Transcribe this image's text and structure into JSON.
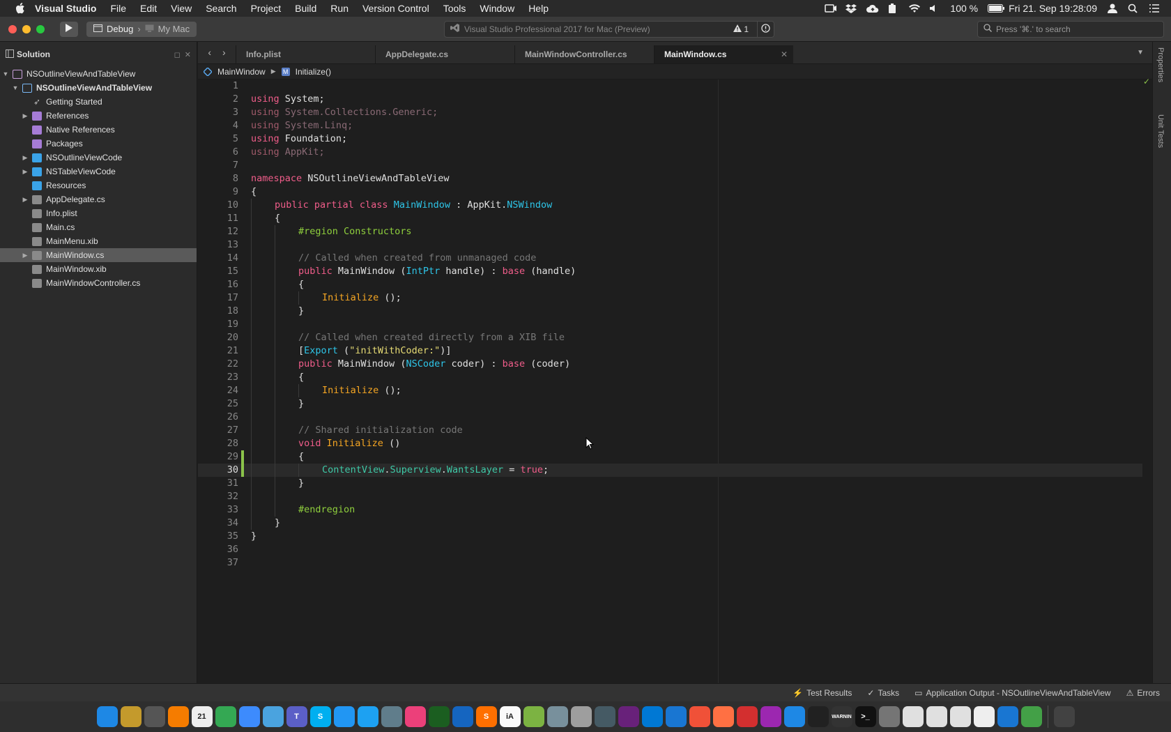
{
  "menubar": {
    "app_name": "Visual Studio",
    "items": [
      "File",
      "Edit",
      "View",
      "Search",
      "Project",
      "Build",
      "Run",
      "Version Control",
      "Tools",
      "Window",
      "Help"
    ],
    "battery": "100 %",
    "clock": "Fri 21. Sep  19:28:09"
  },
  "toolbar": {
    "config": "Debug",
    "target": "My Mac",
    "status_text": "Visual Studio Professional 2017 for Mac (Preview)",
    "warning_count": "1",
    "search_placeholder": "Press '⌘.' to search"
  },
  "solution": {
    "title": "Solution",
    "items": [
      {
        "label": "NSOutlineViewAndTableView",
        "icon": "solution-icon",
        "arrow": "▼",
        "depth": 0,
        "bold": false
      },
      {
        "label": "NSOutlineViewAndTableView",
        "icon": "project-icon",
        "arrow": "▼",
        "depth": 1,
        "bold": true
      },
      {
        "label": "Getting Started",
        "icon": "rocket-icon",
        "arrow": "",
        "depth": 2,
        "bold": false
      },
      {
        "label": "References",
        "icon": "references-icon",
        "arrow": "▶",
        "depth": 2,
        "bold": false
      },
      {
        "label": "Native References",
        "icon": "references-icon",
        "arrow": "",
        "depth": 2,
        "bold": false
      },
      {
        "label": "Packages",
        "icon": "references-icon",
        "arrow": "",
        "depth": 2,
        "bold": false
      },
      {
        "label": "NSOutlineViewCode",
        "icon": "folder-icon",
        "arrow": "▶",
        "depth": 2,
        "bold": false
      },
      {
        "label": "NSTableViewCode",
        "icon": "folder-icon",
        "arrow": "▶",
        "depth": 2,
        "bold": false
      },
      {
        "label": "Resources",
        "icon": "folder-icon",
        "arrow": "",
        "depth": 2,
        "bold": false
      },
      {
        "label": "AppDelegate.cs",
        "icon": "csharp-file-icon",
        "arrow": "▶",
        "depth": 2,
        "bold": false
      },
      {
        "label": "Info.plist",
        "icon": "plist-file-icon",
        "arrow": "",
        "depth": 2,
        "bold": false
      },
      {
        "label": "Main.cs",
        "icon": "csharp-file-icon",
        "arrow": "",
        "depth": 2,
        "bold": false
      },
      {
        "label": "MainMenu.xib",
        "icon": "xib-file-icon",
        "arrow": "",
        "depth": 2,
        "bold": false
      },
      {
        "label": "MainWindow.cs",
        "icon": "csharp-file-icon",
        "arrow": "▶",
        "depth": 2,
        "bold": false,
        "selected": true
      },
      {
        "label": "MainWindow.xib",
        "icon": "xib-file-icon",
        "arrow": "",
        "depth": 2,
        "bold": false
      },
      {
        "label": "MainWindowController.cs",
        "icon": "csharp-file-icon",
        "arrow": "",
        "depth": 2,
        "bold": false
      }
    ]
  },
  "tabs": [
    {
      "label": "Info.plist",
      "active": false
    },
    {
      "label": "AppDelegate.cs",
      "active": false
    },
    {
      "label": "MainWindowController.cs",
      "active": false
    },
    {
      "label": "MainWindow.cs",
      "active": true
    }
  ],
  "pathbar": {
    "class_name": "MainWindow",
    "member": "Initialize()"
  },
  "code": {
    "current_line": 30,
    "changed_lines": [
      29,
      30
    ],
    "lines": [
      {
        "n": 1,
        "indent": 0,
        "tokens": []
      },
      {
        "n": 2,
        "indent": 0,
        "tokens": [
          [
            "k",
            "using"
          ],
          [
            "pl",
            " System;"
          ]
        ]
      },
      {
        "n": 3,
        "indent": 0,
        "tokens": [
          [
            "kd",
            "using"
          ],
          [
            "dim",
            " System.Collections.Generic;"
          ]
        ]
      },
      {
        "n": 4,
        "indent": 0,
        "tokens": [
          [
            "kd",
            "using"
          ],
          [
            "dim",
            " System.Linq;"
          ]
        ]
      },
      {
        "n": 5,
        "indent": 0,
        "tokens": [
          [
            "k",
            "using"
          ],
          [
            "pl",
            " Foundation;"
          ]
        ]
      },
      {
        "n": 6,
        "indent": 0,
        "tokens": [
          [
            "kd",
            "using"
          ],
          [
            "dim",
            " AppKit;"
          ]
        ]
      },
      {
        "n": 7,
        "indent": 0,
        "tokens": []
      },
      {
        "n": 8,
        "indent": 0,
        "tokens": [
          [
            "k",
            "namespace"
          ],
          [
            "pl",
            " NSOutlineViewAndTableView"
          ]
        ]
      },
      {
        "n": 9,
        "indent": 0,
        "tokens": [
          [
            "pl",
            "{"
          ]
        ]
      },
      {
        "n": 10,
        "indent": 1,
        "tokens": [
          [
            "k",
            "public partial class"
          ],
          [
            "pl",
            " "
          ],
          [
            "ty",
            "MainWindow"
          ],
          [
            "pl",
            " : AppKit."
          ],
          [
            "ty",
            "NSWindow"
          ]
        ]
      },
      {
        "n": 11,
        "indent": 1,
        "tokens": [
          [
            "pl",
            "{"
          ]
        ]
      },
      {
        "n": 12,
        "indent": 2,
        "tokens": [
          [
            "pp",
            "#region Constructors"
          ]
        ]
      },
      {
        "n": 13,
        "indent": 2,
        "tokens": []
      },
      {
        "n": 14,
        "indent": 2,
        "tokens": [
          [
            "cm",
            "// Called when created from unmanaged code"
          ]
        ]
      },
      {
        "n": 15,
        "indent": 2,
        "tokens": [
          [
            "k",
            "public"
          ],
          [
            "pl",
            " MainWindow ("
          ],
          [
            "ty",
            "IntPtr"
          ],
          [
            "pl",
            " handle) : "
          ],
          [
            "k",
            "base"
          ],
          [
            "pl",
            " (handle)"
          ]
        ]
      },
      {
        "n": 16,
        "indent": 2,
        "tokens": [
          [
            "pl",
            "{"
          ]
        ]
      },
      {
        "n": 17,
        "indent": 3,
        "tokens": [
          [
            "fn",
            "Initialize"
          ],
          [
            "pl",
            " ();"
          ]
        ]
      },
      {
        "n": 18,
        "indent": 2,
        "tokens": [
          [
            "pl",
            "}"
          ]
        ]
      },
      {
        "n": 19,
        "indent": 2,
        "tokens": []
      },
      {
        "n": 20,
        "indent": 2,
        "tokens": [
          [
            "cm",
            "// Called when created directly from a XIB file"
          ]
        ]
      },
      {
        "n": 21,
        "indent": 2,
        "tokens": [
          [
            "pl",
            "["
          ],
          [
            "ty",
            "Export"
          ],
          [
            "pl",
            " ("
          ],
          [
            "st",
            "\"initWithCoder:\""
          ],
          [
            "pl",
            ")]"
          ]
        ]
      },
      {
        "n": 22,
        "indent": 2,
        "tokens": [
          [
            "k",
            "public"
          ],
          [
            "pl",
            " MainWindow ("
          ],
          [
            "ty",
            "NSCoder"
          ],
          [
            "pl",
            " coder) : "
          ],
          [
            "k",
            "base"
          ],
          [
            "pl",
            " (coder)"
          ]
        ]
      },
      {
        "n": 23,
        "indent": 2,
        "tokens": [
          [
            "pl",
            "{"
          ]
        ]
      },
      {
        "n": 24,
        "indent": 3,
        "tokens": [
          [
            "fn",
            "Initialize"
          ],
          [
            "pl",
            " ();"
          ]
        ]
      },
      {
        "n": 25,
        "indent": 2,
        "tokens": [
          [
            "pl",
            "}"
          ]
        ]
      },
      {
        "n": 26,
        "indent": 2,
        "tokens": []
      },
      {
        "n": 27,
        "indent": 2,
        "tokens": [
          [
            "cm",
            "// Shared initialization code"
          ]
        ]
      },
      {
        "n": 28,
        "indent": 2,
        "tokens": [
          [
            "k",
            "void"
          ],
          [
            "pl",
            " "
          ],
          [
            "fn",
            "Initialize"
          ],
          [
            "pl",
            " ()"
          ]
        ]
      },
      {
        "n": 29,
        "indent": 2,
        "tokens": [
          [
            "pl",
            "{"
          ]
        ]
      },
      {
        "n": 30,
        "indent": 3,
        "tokens": [
          [
            "pr",
            "ContentView"
          ],
          [
            "pl",
            "."
          ],
          [
            "pr",
            "Superview"
          ],
          [
            "pl",
            "."
          ],
          [
            "pr",
            "WantsLayer"
          ],
          [
            "pl",
            " = "
          ],
          [
            "tr",
            "true"
          ],
          [
            "pl",
            ";"
          ]
        ]
      },
      {
        "n": 31,
        "indent": 2,
        "tokens": [
          [
            "pl",
            "}"
          ]
        ]
      },
      {
        "n": 32,
        "indent": 2,
        "tokens": []
      },
      {
        "n": 33,
        "indent": 2,
        "tokens": [
          [
            "pp",
            "#endregion"
          ]
        ]
      },
      {
        "n": 34,
        "indent": 1,
        "tokens": [
          [
            "pl",
            "}"
          ]
        ]
      },
      {
        "n": 35,
        "indent": 0,
        "tokens": [
          [
            "pl",
            "}"
          ]
        ]
      },
      {
        "n": 36,
        "indent": 0,
        "tokens": []
      },
      {
        "n": 37,
        "indent": 0,
        "tokens": []
      }
    ]
  },
  "right_pads": {
    "properties": "Properties",
    "unit_tests": "Unit Tests"
  },
  "statusbar": {
    "test_results": "Test Results",
    "tasks": "Tasks",
    "app_output": "Application Output - NSOutlineViewAndTableView",
    "errors": "Errors"
  },
  "dock": {
    "calendar_day": "21",
    "apps": [
      {
        "name": "finder",
        "color": "#1e88e5",
        "label": ""
      },
      {
        "name": "preview",
        "color": "#c49a2c",
        "label": ""
      },
      {
        "name": "launchpad",
        "color": "#555",
        "label": ""
      },
      {
        "name": "home",
        "color": "#f57c00",
        "label": ""
      },
      {
        "name": "calendar",
        "color": "#eeeeee",
        "label": "21"
      },
      {
        "name": "chrome",
        "color": "#34a853",
        "label": ""
      },
      {
        "name": "mail",
        "color": "#3d8bfd",
        "label": ""
      },
      {
        "name": "tweetbot",
        "color": "#4aa3df",
        "label": ""
      },
      {
        "name": "teams",
        "color": "#5b5fc7",
        "label": "T"
      },
      {
        "name": "skype",
        "color": "#00aff0",
        "label": "S"
      },
      {
        "name": "messages",
        "color": "#2196f3",
        "label": ""
      },
      {
        "name": "twitterrific",
        "color": "#1da1f2",
        "label": ""
      },
      {
        "name": "image-capture",
        "color": "#607d8b",
        "label": ""
      },
      {
        "name": "photos",
        "color": "#ec407a",
        "label": ""
      },
      {
        "name": "sourcetree",
        "color": "#1b5e20",
        "label": ""
      },
      {
        "name": "instruments",
        "color": "#1565c0",
        "label": ""
      },
      {
        "name": "sublime",
        "color": "#ff6f00",
        "label": "S"
      },
      {
        "name": "ia-writer",
        "color": "#fafafa",
        "label": "iA"
      },
      {
        "name": "coda",
        "color": "#7cb342",
        "label": ""
      },
      {
        "name": "tableplus",
        "color": "#78909c",
        "label": ""
      },
      {
        "name": "photo-app",
        "color": "#9e9e9e",
        "label": ""
      },
      {
        "name": "db-app",
        "color": "#455a64",
        "label": ""
      },
      {
        "name": "visual-studio",
        "color": "#68217a",
        "label": ""
      },
      {
        "name": "vscode",
        "color": "#0078d4",
        "label": ""
      },
      {
        "name": "xcode",
        "color": "#1976d2",
        "label": ""
      },
      {
        "name": "swift",
        "color": "#f05138",
        "label": ""
      },
      {
        "name": "swift-playgrounds",
        "color": "#ff7043",
        "label": ""
      },
      {
        "name": "parallels",
        "color": "#d32f2f",
        "label": ""
      },
      {
        "name": "taskheat",
        "color": "#9c27b0",
        "label": ""
      },
      {
        "name": "app-store",
        "color": "#1e88e5",
        "label": ""
      },
      {
        "name": "activity-monitor",
        "color": "#212121",
        "label": ""
      },
      {
        "name": "console",
        "color": "#333",
        "label": "WARNIN"
      },
      {
        "name": "terminal",
        "color": "#111",
        "label": ">_"
      },
      {
        "name": "system-preferences",
        "color": "#757575",
        "label": ""
      },
      {
        "name": "document-1",
        "color": "#e0e0e0",
        "label": ""
      },
      {
        "name": "document-2",
        "color": "#e0e0e0",
        "label": ""
      },
      {
        "name": "document-3",
        "color": "#e0e0e0",
        "label": ""
      },
      {
        "name": "sync-app",
        "color": "#eeeeee",
        "label": ""
      },
      {
        "name": "edge-app",
        "color": "#1976d2",
        "label": ""
      },
      {
        "name": "facetime",
        "color": "#43a047",
        "label": ""
      },
      {
        "name": "trash",
        "color": "#424242",
        "label": ""
      }
    ]
  }
}
